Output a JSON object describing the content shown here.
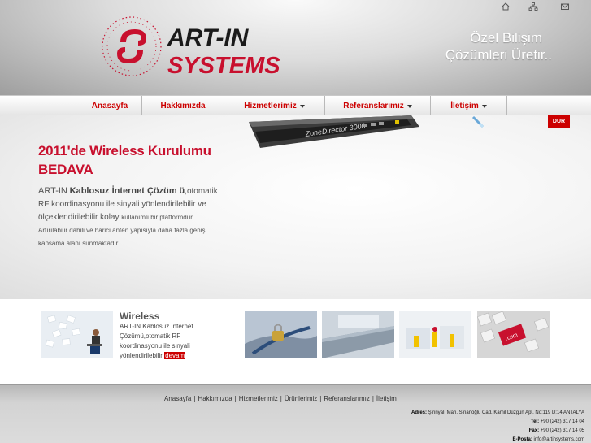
{
  "header": {
    "brand_line1": "ART-IN",
    "brand_line2": "SYSTEMS",
    "slogan_line1": "Özel Bilişim",
    "slogan_line2": "Çözümleri Üretir..",
    "top_icons": [
      "home-icon",
      "sitemap-icon",
      "mail-icon"
    ]
  },
  "nav": {
    "items": [
      {
        "label": "Anasayfa",
        "dropdown": false
      },
      {
        "label": "Hakkımızda",
        "dropdown": false
      },
      {
        "label": "Hizmetlerimiz",
        "dropdown": true
      },
      {
        "label": "Referanslarımız",
        "dropdown": true
      },
      {
        "label": "İletişim",
        "dropdown": true
      }
    ]
  },
  "hero": {
    "stop_label": "DUR",
    "device_label": "ZoneDirector 3000",
    "title_line1": "2011'de Wireless Kurulumu",
    "title_line2": "BEDAVA",
    "text_prefix": "ART-IN",
    "text_bold": "Kablosuz İnternet Çözüm",
    "text_bold2": "ü",
    "text_rest1": ",otomatik RF koordinasyonu ile sinyali yönlendirilebilir ve ölçeklendirilebilir kolay",
    "text_rest2": "kullanımlı bir platformdur. Artırılabilir dahili ve harici anten yapısıyla daha fazla geniş kapsama alanı sunmaktadır."
  },
  "feature": {
    "title": "Wireless",
    "text": "ART-IN Kablosuz İnternet Çözümü,otomatik RF koordinasyonu ile sinyali yönlendirilebilir",
    "more_label": "devam"
  },
  "thumbs": [
    "lock-cable-thumb",
    "laptop-thumb",
    "office-thumb",
    "keyboard-dotcom-thumb"
  ],
  "footer": {
    "links": [
      "Anasayfa",
      "Hakkımızda",
      "Hizmetlerimiz",
      "Ürünlerimiz",
      "Referanslarımız",
      "İletişim"
    ],
    "address_label": "Adres:",
    "address": "Şirinyalı Mah. Sinanoğlu Cad. Kamil Düzgün Apt. No:119 D:14 ANTALYA",
    "tel_label": "Tel:",
    "tel": "+90 (242) 317 14 04",
    "fax_label": "Fax:",
    "fax": "+90 (242) 317 14 05",
    "email_label": "E-Posta:",
    "email": "info@artinsystems.com"
  },
  "colors": {
    "accent": "#c8102e",
    "nav_text": "#cc0000",
    "footer_bg": "#d3d3d3"
  }
}
